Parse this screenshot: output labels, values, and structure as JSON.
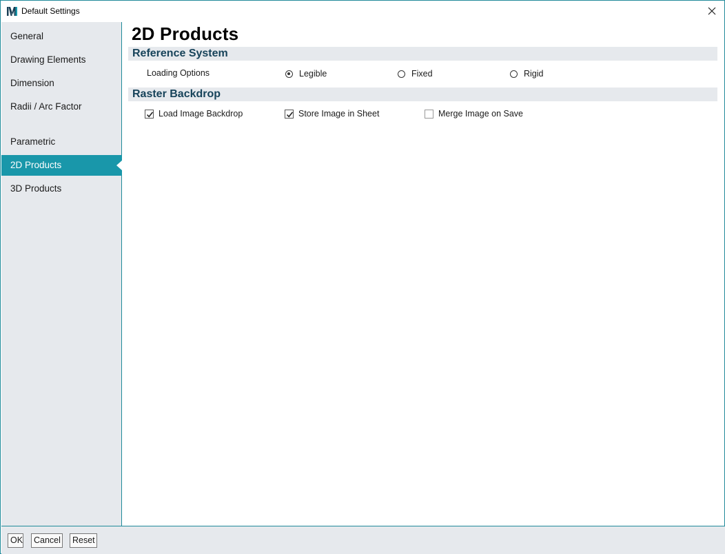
{
  "window": {
    "title": "Default Settings",
    "app_icon": "M",
    "close_icon": "close-icon"
  },
  "sidebar": {
    "items": [
      {
        "label": "General"
      },
      {
        "label": "Drawing Elements"
      },
      {
        "label": "Dimension"
      },
      {
        "label": "Radii / Arc Factor"
      },
      {
        "label": "Parametric"
      },
      {
        "label": "2D Products",
        "active": true
      },
      {
        "label": "3D Products"
      }
    ]
  },
  "main": {
    "title": "2D Products",
    "reference_system": {
      "heading": "Reference System",
      "loading_options_label": "Loading Options",
      "options": [
        {
          "label": "Legible",
          "checked": true
        },
        {
          "label": "Fixed",
          "checked": false
        },
        {
          "label": "Rigid",
          "checked": false
        }
      ]
    },
    "raster_backdrop": {
      "heading": "Raster Backdrop",
      "checkboxes": [
        {
          "label": "Load Image Backdrop",
          "checked": true
        },
        {
          "label": "Store Image in Sheet",
          "checked": true
        },
        {
          "label": "Merge Image on Save",
          "checked": false
        }
      ]
    }
  },
  "footer": {
    "ok_label": "OK",
    "cancel_label": "Cancel",
    "reset_label": "Reset"
  },
  "colors": {
    "accent": "#1997aa",
    "heading": "#17435a",
    "panel": "#e6e9ed"
  }
}
